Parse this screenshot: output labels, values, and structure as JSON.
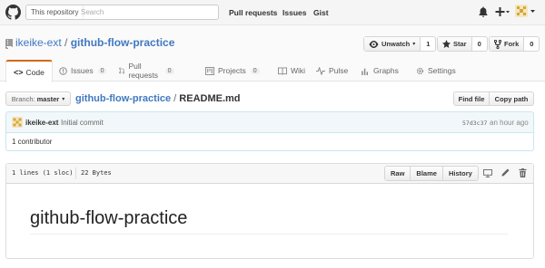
{
  "header": {
    "scope_label": "This repository",
    "search_placeholder": "Search",
    "nav": [
      "Pull requests",
      "Issues",
      "Gist"
    ]
  },
  "repo": {
    "owner": "ikeike-ext",
    "separator": "/",
    "name": "github-flow-practice",
    "actions": {
      "watch_label": "Unwatch",
      "watch_count": "1",
      "star_label": "Star",
      "star_count": "0",
      "fork_label": "Fork",
      "fork_count": "0"
    },
    "tabs": [
      {
        "label": "Code"
      },
      {
        "label": "Issues",
        "count": "0"
      },
      {
        "label": "Pull requests",
        "count": "0"
      },
      {
        "label": "Projects",
        "count": "0"
      },
      {
        "label": "Wiki"
      },
      {
        "label": "Pulse"
      },
      {
        "label": "Graphs"
      },
      {
        "label": "Settings"
      }
    ]
  },
  "file_nav": {
    "branch_prefix": "Branch:",
    "branch": "master",
    "breadcrumb_repo": "github-flow-practice",
    "breadcrumb_sep": "/",
    "file_name": "README.md",
    "find_file": "Find file",
    "copy_path": "Copy path"
  },
  "commit": {
    "author": "ikeike-ext",
    "message": "Initial commit",
    "sha": "57d3c37",
    "time": "an hour ago",
    "contributors": "1 contributor"
  },
  "file": {
    "lines": "1 lines (1 sloc)",
    "size": "22 Bytes",
    "buttons": [
      "Raw",
      "Blame",
      "History"
    ],
    "heading": "github-flow-practice"
  },
  "colors": {
    "accent_tab": "#d26911",
    "link": "#4078c0",
    "commit_bg": "#f2f8fa"
  }
}
